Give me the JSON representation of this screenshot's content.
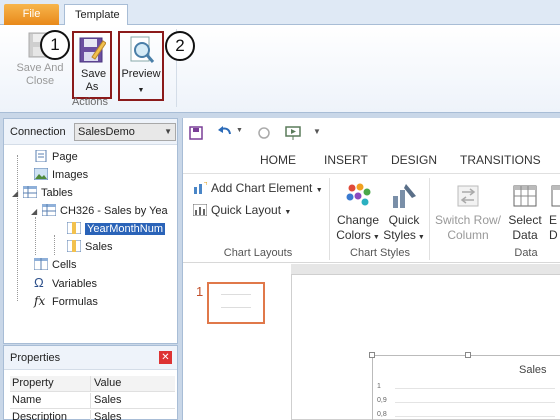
{
  "tabs": {
    "file": "File",
    "template": "Template"
  },
  "ribbon": {
    "save_and_close": "Save And Close",
    "save_as": "Save As",
    "preview": "Preview",
    "actions_group": "Actions"
  },
  "callouts": [
    "1",
    "2"
  ],
  "connection": {
    "label": "Connection",
    "value": "SalesDemo"
  },
  "tree": {
    "page": "Page",
    "images": "Images",
    "tables": "Tables",
    "table_name": "CH326 - Sales by Yea",
    "col_yearmonth": "YearMonthNum",
    "col_sales": "Sales",
    "cells": "Cells",
    "variables": "Variables",
    "formulas": "Formulas"
  },
  "properties": {
    "title": "Properties",
    "headers": [
      "Property",
      "Value"
    ],
    "rows": [
      [
        "Name",
        "Sales"
      ],
      [
        "Description",
        "Sales"
      ]
    ]
  },
  "ppt": {
    "tabs": [
      "HOME",
      "INSERT",
      "DESIGN",
      "TRANSITIONS"
    ],
    "add_chart_element": "Add Chart Element",
    "quick_layout": "Quick Layout",
    "change_colors": [
      "Change",
      "Colors"
    ],
    "quick_styles": [
      "Quick",
      "Styles"
    ],
    "switch_row_column": [
      "Switch Row/",
      "Column"
    ],
    "select_data": [
      "Select",
      "Data"
    ],
    "edit_data_partial": [
      "E",
      "D"
    ],
    "groups": {
      "chart_layouts": "Chart Layouts",
      "chart_styles": "Chart Styles",
      "data": "Data"
    },
    "slide_number": "1",
    "chart_title": "Sales",
    "y_ticks": [
      "1",
      "0,9",
      "0,8"
    ]
  },
  "colors": {
    "file_tab": "#e8891a",
    "highlight_border": "#8b1a1a",
    "selection": "#2a63b8",
    "thumb_border": "#e0784a"
  }
}
